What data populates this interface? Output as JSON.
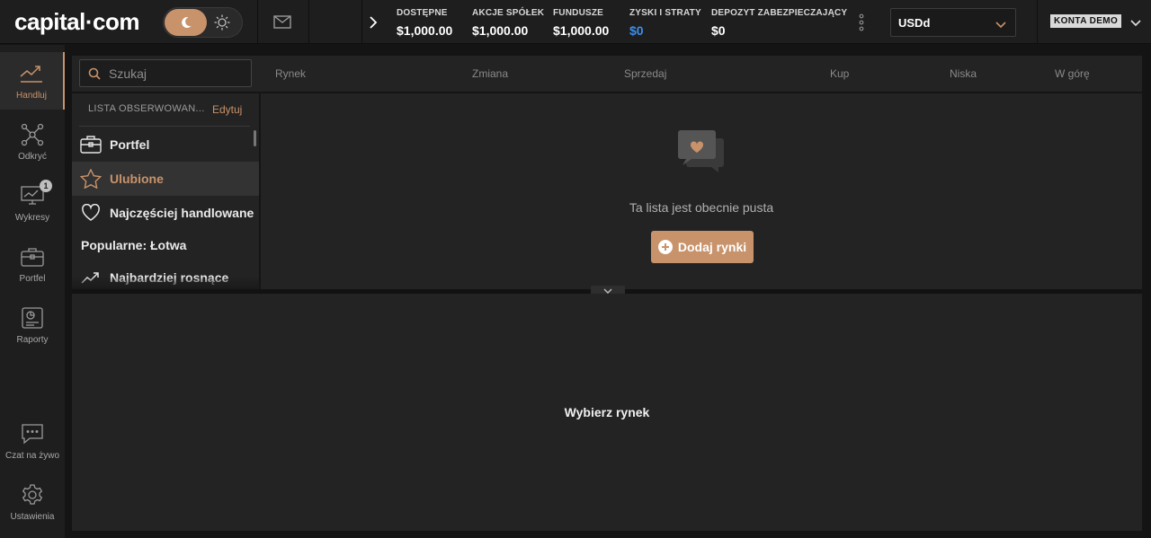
{
  "brand": {
    "logo_left": "capital",
    "logo_dot": "·",
    "logo_right": "com",
    "accent": "#c8926a",
    "blue": "#3d8ee8"
  },
  "header": {
    "stats": [
      {
        "label": "DOSTĘPNE",
        "value": "$1,000.00"
      },
      {
        "label": "AKCJE SPÓŁEK",
        "value": "$1,000.00"
      },
      {
        "label": "FUNDUSZE",
        "value": "$1,000.00"
      },
      {
        "label": "ZYSKI I STRATY",
        "value": "$0"
      },
      {
        "label": "DEPOZYT ZABEZPIECZAJĄCY",
        "value": "$0"
      }
    ],
    "account_select": "USDd",
    "demo_badge": "KONTA DEMO"
  },
  "sidebar": {
    "items": [
      {
        "label": "Handluj",
        "icon": "trending-chart-icon"
      },
      {
        "label": "Odkryć",
        "icon": "network-icon"
      },
      {
        "label": "Wykresy",
        "icon": "monitor-chart-icon",
        "badge": "1"
      },
      {
        "label": "Portfel",
        "icon": "briefcase-icon"
      },
      {
        "label": "Raporty",
        "icon": "report-icon"
      },
      {
        "label": "Czat na żywo",
        "icon": "chat-icon"
      },
      {
        "label": "Ustawienia",
        "icon": "gear-icon"
      }
    ]
  },
  "search": {
    "placeholder": "Szukaj"
  },
  "watchlist": {
    "header": "LISTA OBSERWOWAN...",
    "edit": "Edytuj",
    "items": [
      {
        "label": "Portfel",
        "icon": "briefcase-icon"
      },
      {
        "label": "Ulubione",
        "icon": "star-icon"
      },
      {
        "label": "Najczęściej handlowane",
        "icon": "heart-icon"
      },
      {
        "label": "Popularne: Łotwa"
      },
      {
        "label": "Najbardziej rosnące",
        "icon": "trend-up-icon"
      }
    ]
  },
  "market_table": {
    "columns": [
      "Rynek",
      "Zmiana",
      "Sprzedaj",
      "Kup",
      "Niska",
      "W górę"
    ],
    "empty_text": "Ta lista jest obecnie pusta",
    "add_button": "Dodaj rynki"
  },
  "detail": {
    "placeholder": "Wybierz rynek"
  }
}
